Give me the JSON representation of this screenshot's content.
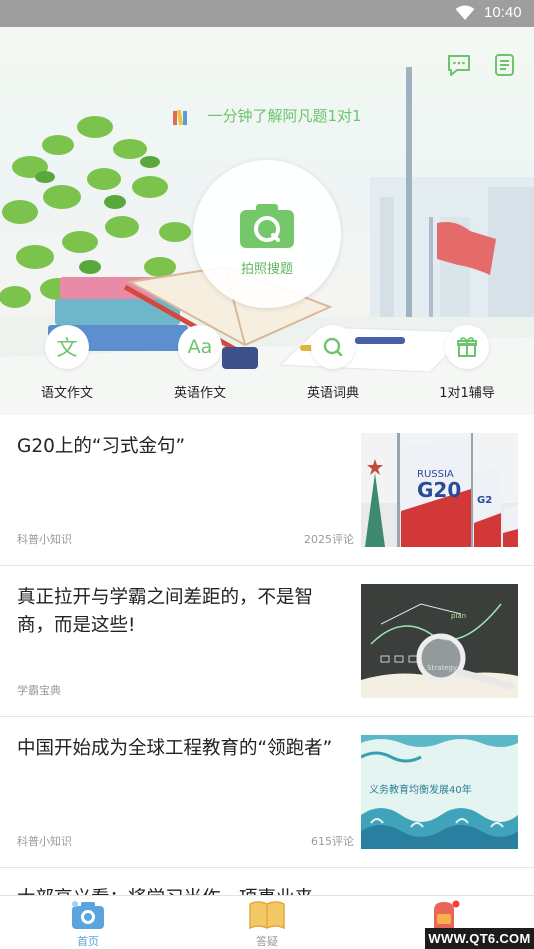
{
  "status_bar": {
    "time": "10:40"
  },
  "header": {
    "banner_text": "一分钟了解阿凡题1对1",
    "camera_label": "拍照搜题",
    "top_icons": [
      "chat-icon",
      "notes-icon"
    ],
    "accent_color": "#6dc36e"
  },
  "shortcuts": [
    {
      "label": "语文作文",
      "icon": "wen-icon"
    },
    {
      "label": "英语作文",
      "icon": "aa-icon"
    },
    {
      "label": "英语词典",
      "icon": "dictionary-search-icon"
    },
    {
      "label": "1对1辅导",
      "icon": "gift-icon"
    }
  ],
  "articles": [
    {
      "title": "G20上的“习式金句”",
      "source": "科普小知识",
      "comments": "2025评论",
      "thumb": "g20-flags"
    },
    {
      "title": "真正拉开与学霸之间差距的，不是智商，而是这些!",
      "source": "学霸宝典",
      "comments": "",
      "thumb": "chalkboard-magnifier"
    },
    {
      "title": "中国开始成为全球工程教育的“领跑者”",
      "source": "科普小知识",
      "comments": "615评论",
      "thumb": "waves-calligraphy"
    }
  ],
  "partial_article": {
    "title": "大部高义看：将学习当作一项事业来"
  },
  "bottom_nav": [
    {
      "label": "首页",
      "icon": "camera-home-icon",
      "active": true
    },
    {
      "label": "答疑",
      "icon": "book-icon",
      "active": false
    },
    {
      "label": "",
      "icon": "backpack-icon",
      "active": false
    }
  ],
  "watermark": "WWW.QT6.COM"
}
